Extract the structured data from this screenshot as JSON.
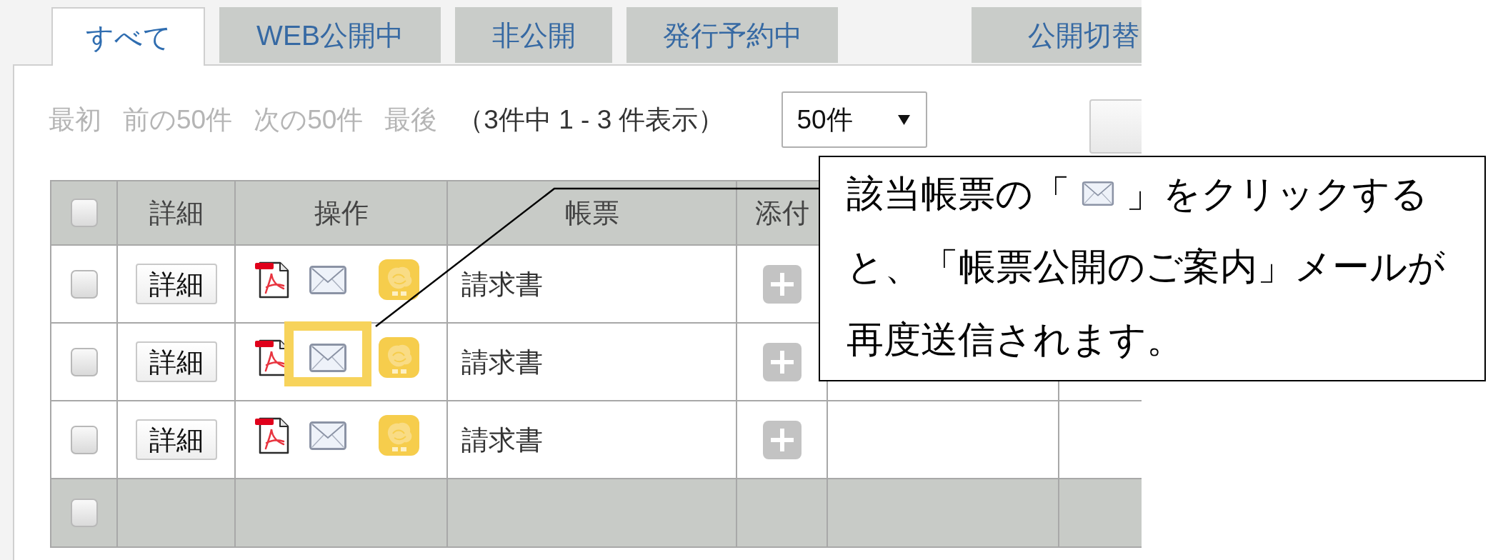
{
  "tabs": [
    {
      "label": "すべて",
      "selected": true
    },
    {
      "label": "WEB公開中",
      "selected": false
    },
    {
      "label": "非公開",
      "selected": false
    },
    {
      "label": "発行予約中",
      "selected": false
    },
    {
      "label": "公開切替",
      "selected": false
    }
  ],
  "pagination": {
    "links": [
      {
        "label": "最初",
        "disabled": true
      },
      {
        "label": "前の50件",
        "disabled": true
      },
      {
        "label": "次の50件",
        "disabled": true
      },
      {
        "label": "最後",
        "disabled": true
      }
    ],
    "summary": "（3件中 1 - 3 件表示）",
    "page_size": "50件"
  },
  "table": {
    "header_checked": false,
    "columns": [
      "詳細",
      "操作",
      "帳票",
      "添付"
    ],
    "rows": [
      {
        "checked": false,
        "detail_button": "詳細",
        "document": "請求書",
        "mail_highlighted": false
      },
      {
        "checked": false,
        "detail_button": "詳細",
        "document": "請求書",
        "mail_highlighted": true
      },
      {
        "checked": false,
        "detail_button": "詳細",
        "document": "請求書",
        "mail_highlighted": false
      }
    ],
    "footer_checked": false
  },
  "callout": {
    "lines": [
      {
        "kind": "icon_line",
        "before": "該当帳票の「",
        "after": "」をクリックする"
      },
      {
        "kind": "text",
        "text": "と、「帳票公開のご案内」メールが"
      },
      {
        "kind": "text",
        "text": "再度送信されます。"
      }
    ]
  }
}
